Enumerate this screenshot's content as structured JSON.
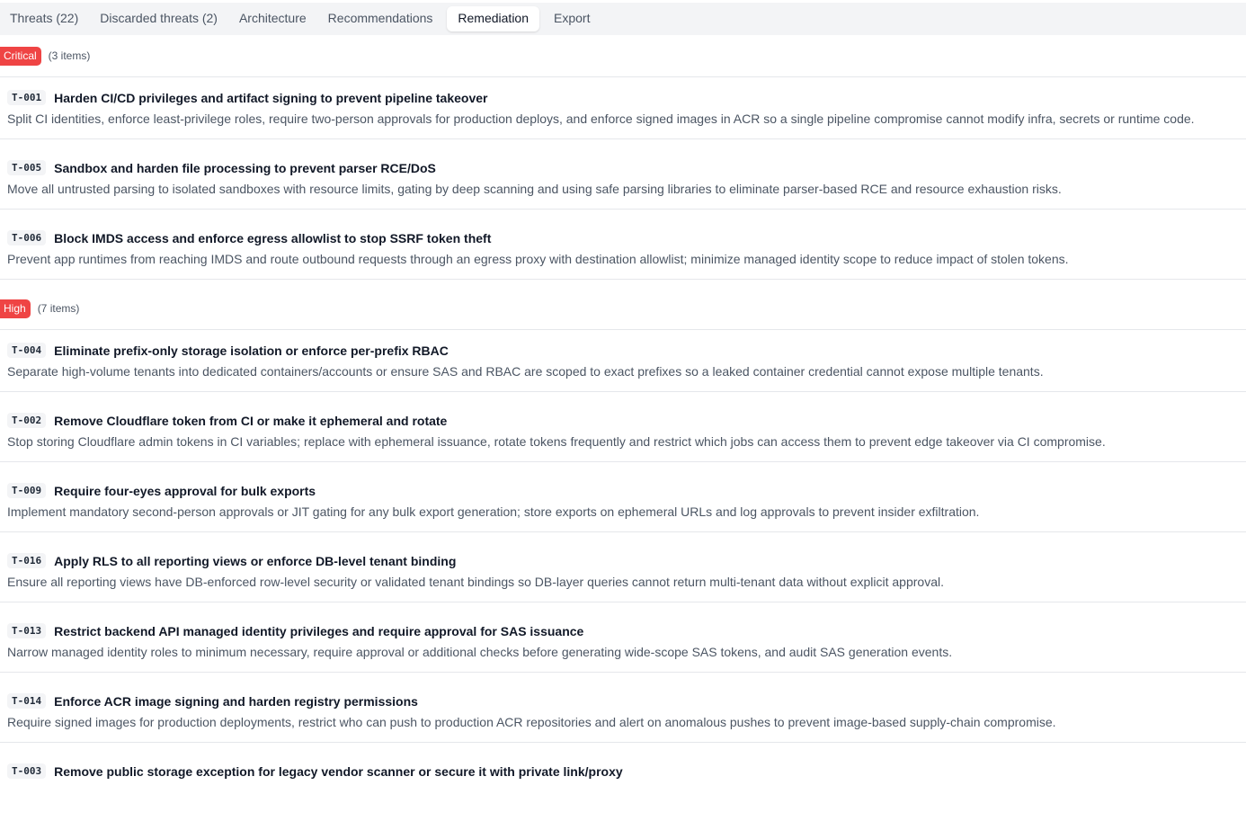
{
  "tabs": [
    {
      "label": "Threats (22)",
      "active": false
    },
    {
      "label": "Discarded threats (2)",
      "active": false
    },
    {
      "label": "Architecture",
      "active": false
    },
    {
      "label": "Recommendations",
      "active": false
    },
    {
      "label": "Remediation",
      "active": true
    },
    {
      "label": "Export",
      "active": false
    }
  ],
  "colors": {
    "critical": "#ef4444",
    "high": "#ef4444"
  },
  "groups": [
    {
      "label": "Critical",
      "count": "(3 items)",
      "items": [
        {
          "id": "T-001",
          "title": "Harden CI/CD privileges and artifact signing to prevent pipeline takeover",
          "desc": "Split CI identities, enforce least-privilege roles, require two-person approvals for production deploys, and enforce signed images in ACR so a single pipeline compromise cannot modify infra, secrets or runtime code."
        },
        {
          "id": "T-005",
          "title": "Sandbox and harden file processing to prevent parser RCE/DoS",
          "desc": "Move all untrusted parsing to isolated sandboxes with resource limits, gating by deep scanning and using safe parsing libraries to eliminate parser-based RCE and resource exhaustion risks."
        },
        {
          "id": "T-006",
          "title": "Block IMDS access and enforce egress allowlist to stop SSRF token theft",
          "desc": "Prevent app runtimes from reaching IMDS and route outbound requests through an egress proxy with destination allowlist; minimize managed identity scope to reduce impact of stolen tokens."
        }
      ]
    },
    {
      "label": "High",
      "count": "(7 items)",
      "items": [
        {
          "id": "T-004",
          "title": "Eliminate prefix-only storage isolation or enforce per-prefix RBAC",
          "desc": "Separate high-volume tenants into dedicated containers/accounts or ensure SAS and RBAC are scoped to exact prefixes so a leaked container credential cannot expose multiple tenants."
        },
        {
          "id": "T-002",
          "title": "Remove Cloudflare token from CI or make it ephemeral and rotate",
          "desc": "Stop storing Cloudflare admin tokens in CI variables; replace with ephemeral issuance, rotate tokens frequently and restrict which jobs can access them to prevent edge takeover via CI compromise."
        },
        {
          "id": "T-009",
          "title": "Require four-eyes approval for bulk exports",
          "desc": "Implement mandatory second-person approvals or JIT gating for any bulk export generation; store exports on ephemeral URLs and log approvals to prevent insider exfiltration."
        },
        {
          "id": "T-016",
          "title": "Apply RLS to all reporting views or enforce DB-level tenant binding",
          "desc": "Ensure all reporting views have DB-enforced row-level security or validated tenant bindings so DB-layer queries cannot return multi-tenant data without explicit approval."
        },
        {
          "id": "T-013",
          "title": "Restrict backend API managed identity privileges and require approval for SAS issuance",
          "desc": "Narrow managed identity roles to minimum necessary, require approval or additional checks before generating wide-scope SAS tokens, and audit SAS generation events."
        },
        {
          "id": "T-014",
          "title": "Enforce ACR image signing and harden registry permissions",
          "desc": "Require signed images for production deployments, restrict who can push to production ACR repositories and alert on anomalous pushes to prevent image-based supply-chain compromise."
        },
        {
          "id": "T-003",
          "title": "Remove public storage exception for legacy vendor scanner or secure it with private link/proxy",
          "desc": ""
        }
      ]
    }
  ]
}
